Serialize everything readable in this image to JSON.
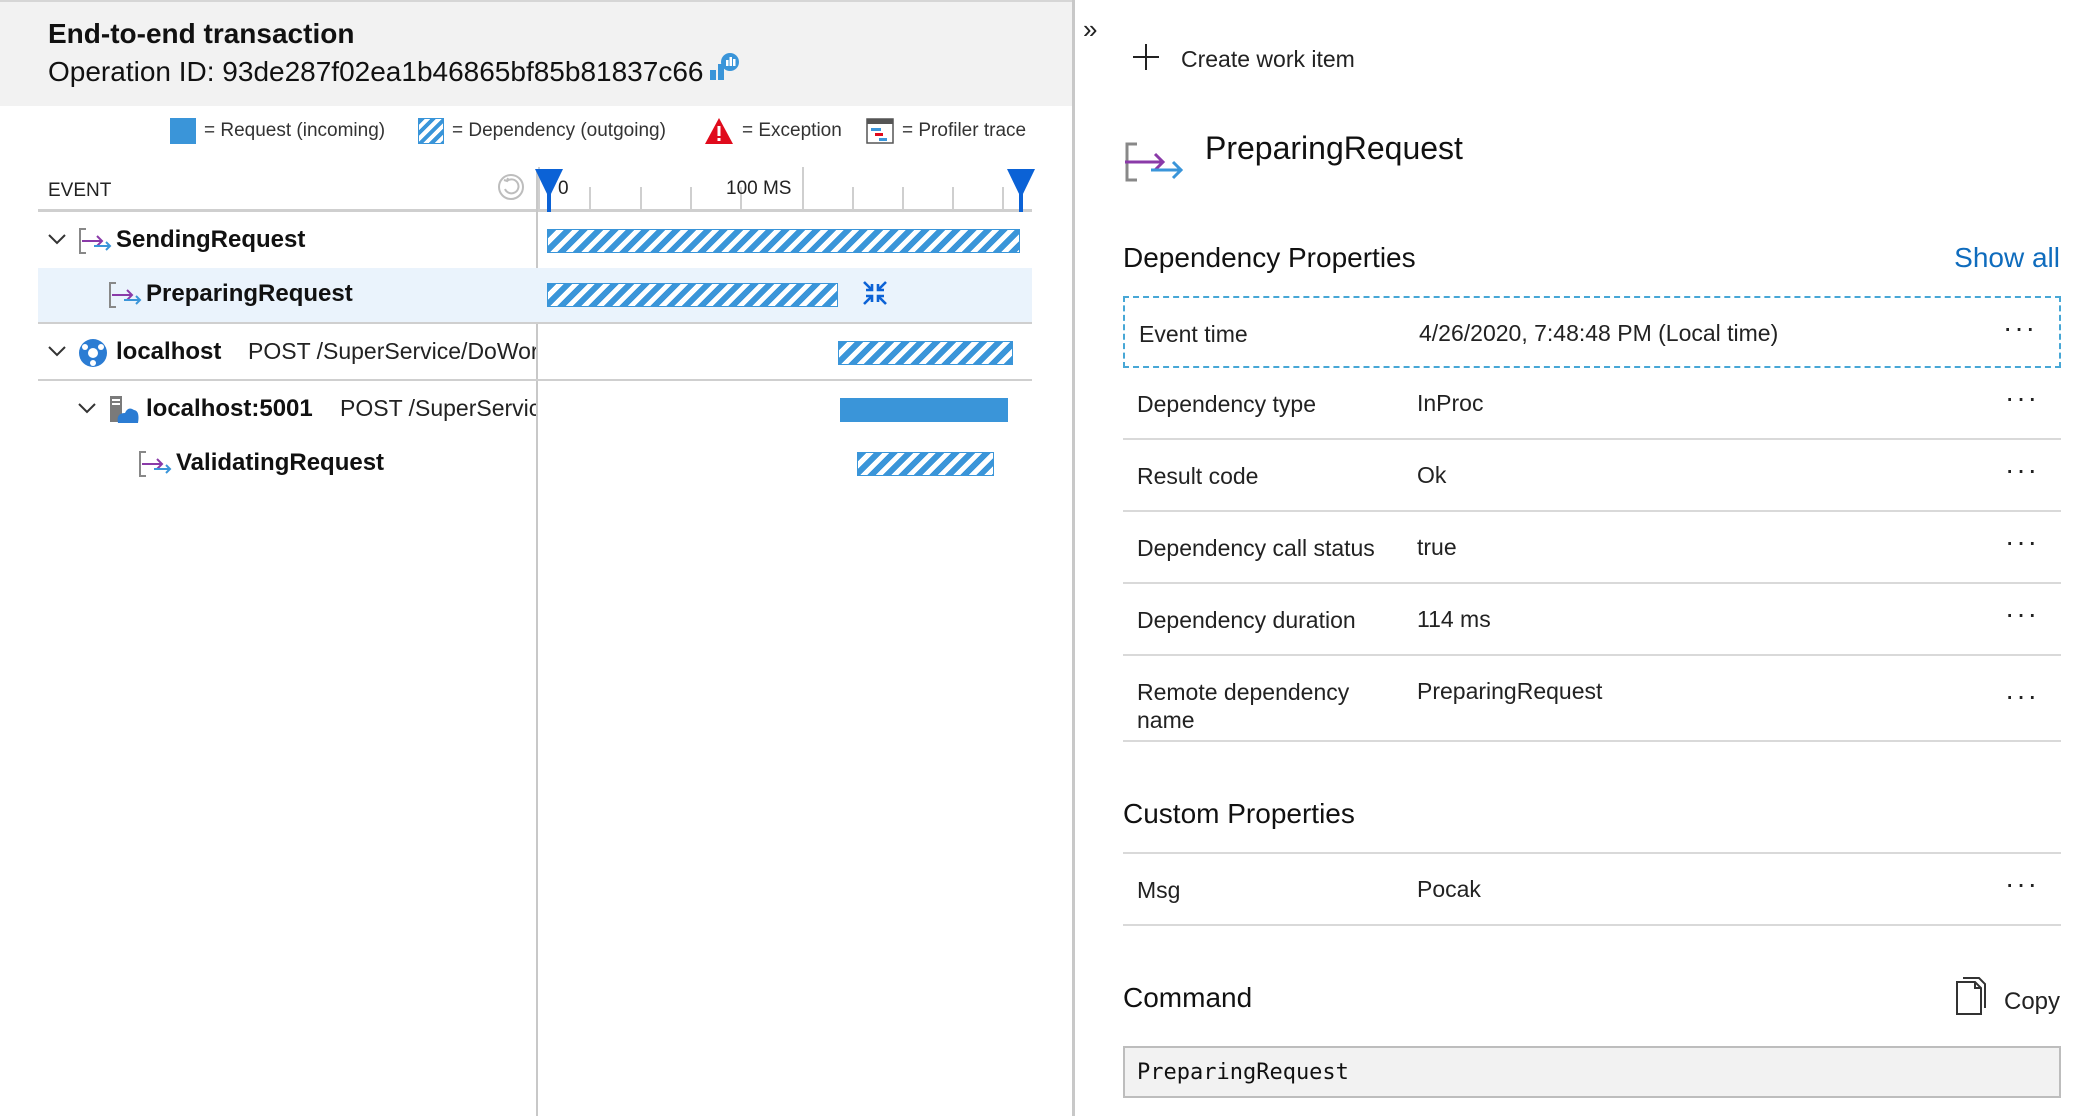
{
  "header": {
    "title": "End-to-end transaction",
    "operation": "Operation ID: 93de287f02ea1b46865bf85b81837c66"
  },
  "legend": [
    {
      "label": "= Request (incoming)"
    },
    {
      "label": "= Dependency (outgoing)"
    },
    {
      "label": "= Exception"
    },
    {
      "label": "= Profiler trace"
    }
  ],
  "timeline": {
    "event_header": "EVENT",
    "axis_labels": [
      "0",
      "100 MS"
    ]
  },
  "rows": [
    {
      "name": "SendingRequest",
      "detail": "",
      "type": "dependency",
      "expanded": true,
      "start_fraction": 0.0,
      "end_fraction": 1.0
    },
    {
      "name": "PreparingRequest",
      "detail": "",
      "type": "dependency",
      "selected": true,
      "start_fraction": 0.0,
      "end_fraction": 0.615
    },
    {
      "name": "localhost",
      "detail": "POST /SuperService/DoWork",
      "type": "dependency",
      "expanded": true,
      "start_fraction": 0.615,
      "end_fraction": 0.985
    },
    {
      "name": "localhost:5001",
      "detail": "POST /SuperService/DoWork",
      "type": "request",
      "expanded": true,
      "start_fraction": 0.62,
      "end_fraction": 0.975
    },
    {
      "name": "ValidatingRequest",
      "detail": "",
      "type": "dependency",
      "start_fraction": 0.655,
      "end_fraction": 0.945
    }
  ],
  "details": {
    "collapse_glyph": "»",
    "create_work_item": "Create work item",
    "title": "PreparingRequest",
    "dependency_section": "Dependency Properties",
    "show_all": "Show all",
    "properties": [
      {
        "key": "Event time",
        "value": "4/26/2020, 7:48:48 PM (Local time)"
      },
      {
        "key": "Dependency type",
        "value": "InProc"
      },
      {
        "key": "Result code",
        "value": "Ok"
      },
      {
        "key": "Dependency call status",
        "value": "true"
      },
      {
        "key": "Dependency duration",
        "value": "114 ms"
      },
      {
        "key": "Remote dependency name",
        "value": "PreparingRequest"
      }
    ],
    "custom_section": "Custom Properties",
    "custom_properties": [
      {
        "key": "Msg",
        "value": "Pocak"
      }
    ],
    "command_section": "Command",
    "copy_label": "Copy",
    "command_text": "PreparingRequest",
    "more_glyph": "···"
  },
  "colors": {
    "accent": "#0f6cbd",
    "bar": "#3a95d9",
    "selected_row": "#eaf3fc",
    "focus_border": "#47a7d6",
    "marker": "#0b62d6"
  }
}
